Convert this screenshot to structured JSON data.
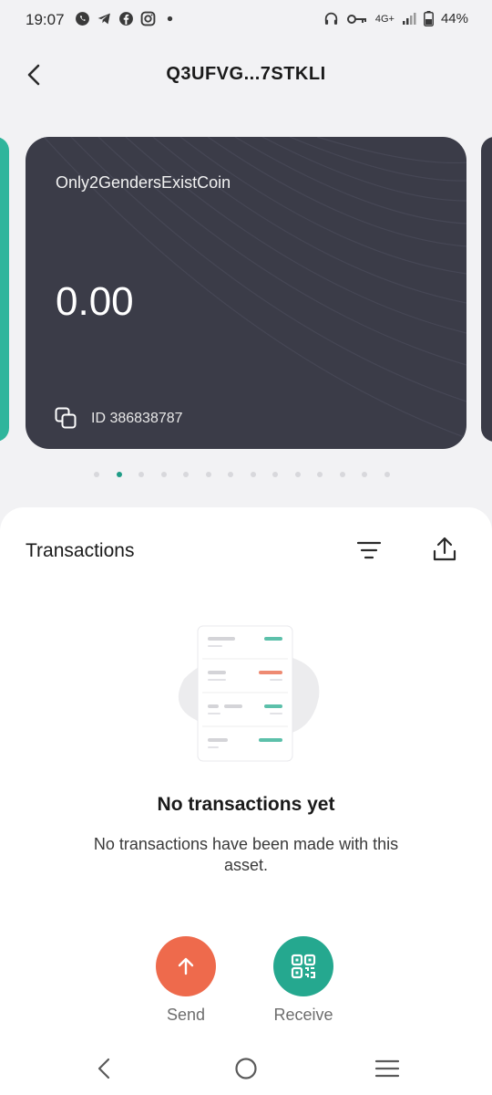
{
  "status_bar": {
    "time": "19:07",
    "network": "4G+",
    "battery": "44%"
  },
  "header": {
    "title": "Q3UFVG...7STKLI"
  },
  "card": {
    "asset_name": "Only2GendersExistCoin",
    "balance": "0.00",
    "id_label": "ID 386838787",
    "color": "#3b3c48"
  },
  "pagination": {
    "total": 14,
    "active_index": 1
  },
  "transactions": {
    "title": "Transactions",
    "empty_title": "No transactions yet",
    "empty_description": "No transactions have been made with this asset."
  },
  "actions": {
    "send_label": "Send",
    "receive_label": "Receive",
    "send_color": "#ee6a4c",
    "receive_color": "#25a88f"
  },
  "icons": {
    "back": "chevron-left-icon",
    "copy": "copy-icon",
    "filter": "filter-icon",
    "export": "share-upload-icon",
    "send": "arrow-up-icon",
    "receive": "qr-code-icon"
  }
}
